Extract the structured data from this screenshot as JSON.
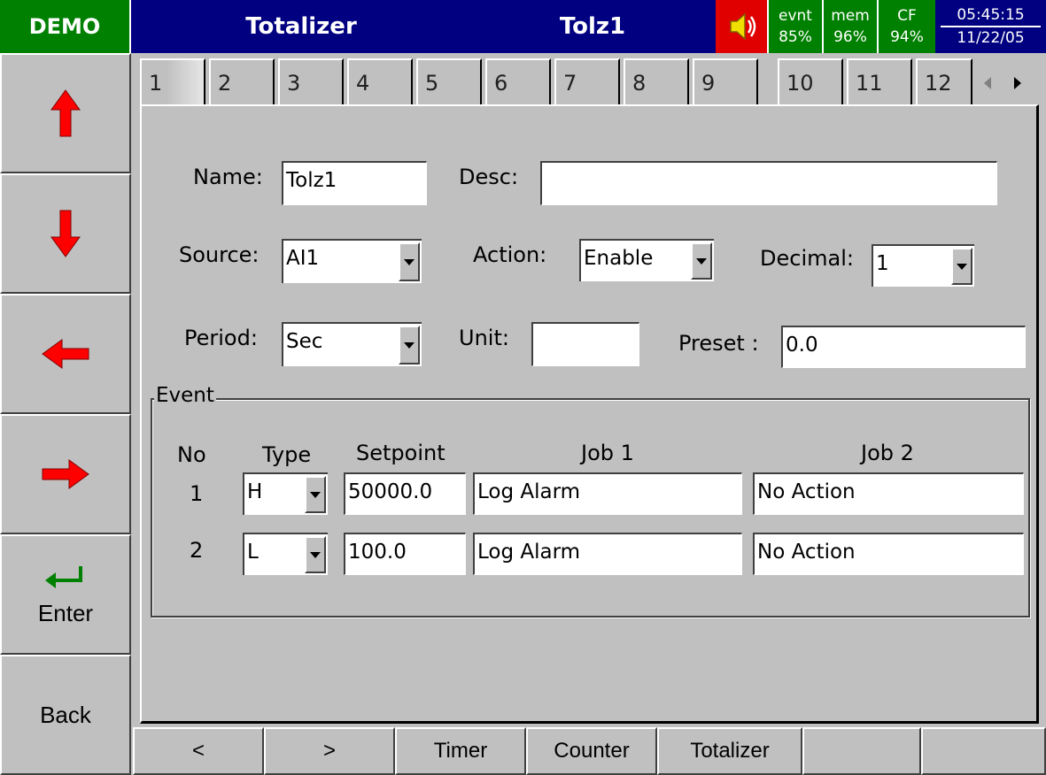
{
  "header": {
    "brand": "DEMO",
    "screen_title": "Totalizer",
    "item_title": "Tolz1",
    "status": [
      {
        "label": "evnt",
        "value": "85%"
      },
      {
        "label": "mem",
        "value": "96%"
      },
      {
        "label": "CF",
        "value": "94%"
      }
    ],
    "time": "05:45:15",
    "date": "11/22/05"
  },
  "sidebar": {
    "up_icon": "arrow-up-icon",
    "down_icon": "arrow-down-icon",
    "left_icon": "arrow-left-icon",
    "right_icon": "arrow-right-icon",
    "enter_label": "Enter",
    "back_label": "Back"
  },
  "tabs": [
    "1",
    "2",
    "3",
    "4",
    "5",
    "6",
    "7",
    "8",
    "9",
    "10",
    "11",
    "12"
  ],
  "form": {
    "name_label": "Name:",
    "name_value": "Tolz1",
    "desc_label": "Desc:",
    "desc_value": "",
    "source_label": "Source:",
    "source_value": "AI1",
    "action_label": "Action:",
    "action_value": "Enable",
    "decimal_label": "Decimal:",
    "decimal_value": "1",
    "period_label": "Period:",
    "period_value": "Sec",
    "unit_label": "Unit:",
    "unit_value": "",
    "preset_label": "Preset :",
    "preset_value": "0.0"
  },
  "event": {
    "title": "Event",
    "headers": {
      "no": "No",
      "type": "Type",
      "setpoint": "Setpoint",
      "job1": "Job 1",
      "job2": "Job 2"
    },
    "rows": [
      {
        "no": "1",
        "type": "H",
        "setpoint": "50000.0",
        "job1": "Log Alarm",
        "job2": "No Action"
      },
      {
        "no": "2",
        "type": "L",
        "setpoint": "100.0",
        "job1": "Log Alarm",
        "job2": "No Action"
      }
    ]
  },
  "bottombar": {
    "prev": "<",
    "next": ">",
    "timer": "Timer",
    "counter": "Counter",
    "totalizer": "Totalizer"
  },
  "colors": {
    "title_bar": "#000080",
    "demo_bg": "#008000",
    "status_bg": "#008000",
    "speaker_bg": "#e00000",
    "arrow_red": "#ff0000",
    "enter_green": "#008000",
    "face": "#c0c0c0"
  }
}
